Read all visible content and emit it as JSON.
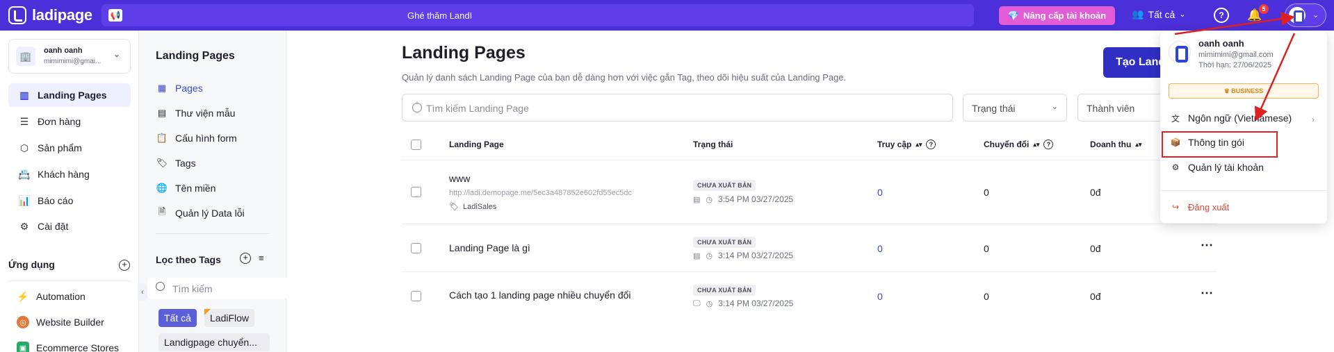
{
  "topbar": {
    "logo_text": "ladipage",
    "banner_text": "Ghé thăm LandI",
    "upgrade_label": "Nâng cấp tài khoản",
    "filter_label": "Tất cả",
    "notification_count": "5"
  },
  "account": {
    "name": "oanh oanh",
    "email": "mimimimi@gmai..."
  },
  "nav": {
    "items": [
      {
        "label": "Landing Pages"
      },
      {
        "label": "Đơn hàng"
      },
      {
        "label": "Sản phẩm"
      },
      {
        "label": "Khách hàng"
      },
      {
        "label": "Báo cáo"
      },
      {
        "label": "Cài đặt"
      }
    ],
    "apps_title": "Ứng dụng",
    "apps": [
      {
        "label": "Automation"
      },
      {
        "label": "Website Builder"
      },
      {
        "label": "Ecommerce Stores"
      }
    ]
  },
  "subnav": {
    "title": "Landing Pages",
    "items": [
      {
        "label": "Pages"
      },
      {
        "label": "Thư viện mẫu"
      },
      {
        "label": "Cấu hình form"
      },
      {
        "label": "Tags"
      },
      {
        "label": "Tên miền"
      },
      {
        "label": "Quản lý Data lỗi"
      }
    ],
    "tags_title": "Lọc theo Tags",
    "tag_search_placeholder": "Tìm kiếm",
    "tags": [
      "Tất cả",
      "LadiFlow",
      "Landigpage chuyển..."
    ]
  },
  "main": {
    "title": "Landing Pages",
    "description": "Quản lý danh sách Landing Page của bạn dễ dàng hơn với việc gắn Tag, theo dõi hiệu suất của Landing Page.",
    "create_label": "Tạo Landing Page",
    "search_placeholder": "Tìm kiếm Landing Page",
    "status_filter": "Trạng thái",
    "member_filter": "Thành viên",
    "columns": {
      "landing_page": "Landing Page",
      "status": "Trạng thái",
      "visits": "Truy cập",
      "conversions": "Chuyển đổi",
      "revenue": "Doanh thu"
    },
    "rows": [
      {
        "name": "www",
        "url": "http://ladi.demopage.me/5ec3a487852e602fd55ec5dc",
        "tag": "LadiSales",
        "status": "CHƯA XUẤT BẢN",
        "time": "3:54 PM 03/27/2025",
        "visits": "0",
        "conversions": "0",
        "revenue": "0đ"
      },
      {
        "name": "Landing Page là gì",
        "status": "CHƯA XUẤT BẢN",
        "time": "3:14 PM 03/27/2025",
        "visits": "0",
        "conversions": "0",
        "revenue": "0đ"
      },
      {
        "name": "Cách tạo 1 landing page nhiều chuyển đổi",
        "status": "CHƯA XUẤT BẢN",
        "time": "3:14 PM 03/27/2025",
        "visits": "0",
        "conversions": "0",
        "revenue": "0đ"
      }
    ]
  },
  "dropdown": {
    "name": "oanh oanh",
    "email": "mimimimi@gmail.com",
    "expiry": "Thời hạn: 27/06/2025",
    "plan": "BUSINESS",
    "language": "Ngôn ngữ (Vietnamese)",
    "package_info": "Thông tin gói",
    "account_manage": "Quản lý tài khoản",
    "logout": "Đăng xuất"
  },
  "colors": {
    "topbar": "#4b2fd8",
    "primary": "#2f2fc4",
    "upgrade": "#e25bd7",
    "annotation": "#e02020"
  }
}
